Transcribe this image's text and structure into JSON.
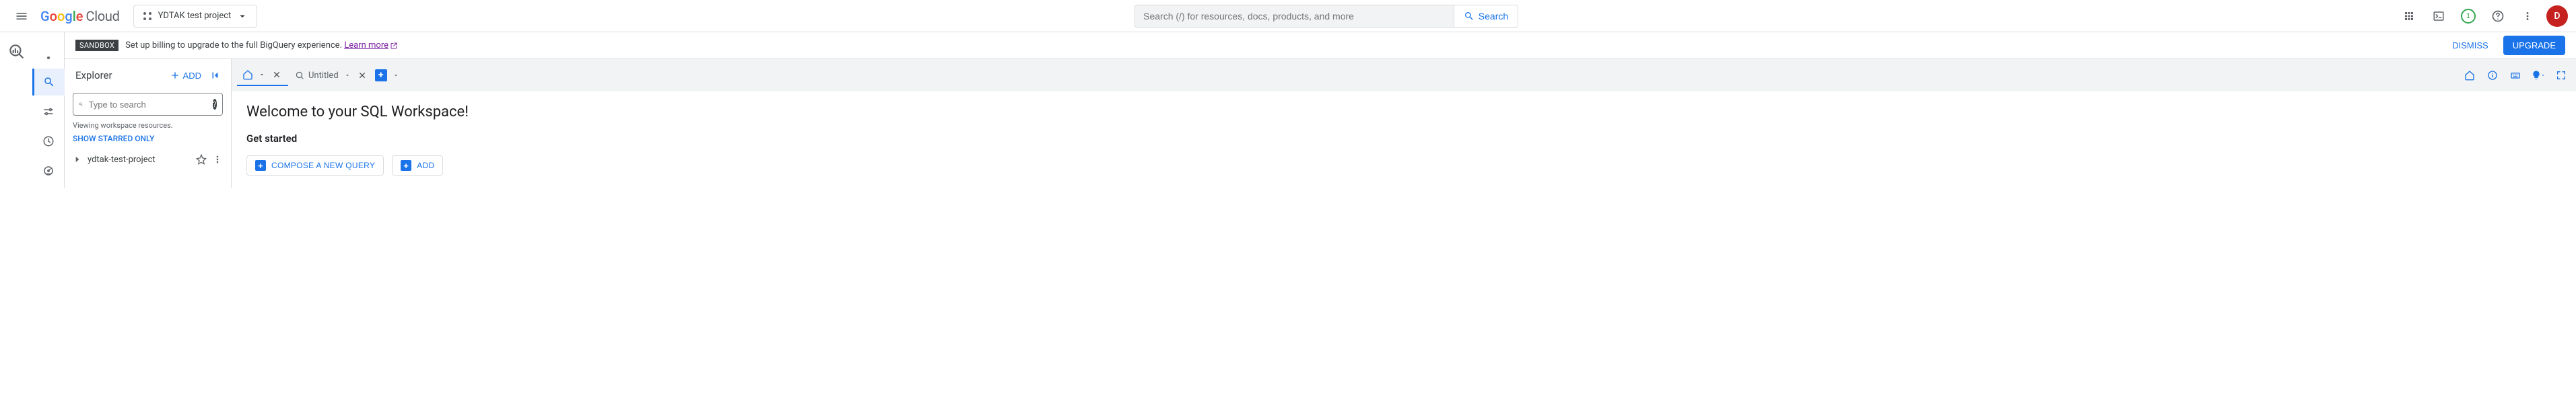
{
  "header": {
    "logo_cloud": "Cloud",
    "project_name": "YDTAK test project",
    "search_placeholder": "Search (/) for resources, docs, products, and more",
    "search_button": "Search",
    "notif_count": "1",
    "avatar_letter": "D"
  },
  "sandbox": {
    "badge": "SANDBOX",
    "text": "Set up billing to upgrade to the full BigQuery experience.",
    "link": "Learn more",
    "dismiss": "DISMISS",
    "upgrade": "UPGRADE"
  },
  "explorer": {
    "title": "Explorer",
    "add": "ADD",
    "search_placeholder": "Type to search",
    "viewing": "Viewing workspace resources.",
    "starred_link": "SHOW STARRED ONLY",
    "project": "ydtak-test-project"
  },
  "tabs": {
    "untitled": "Untitled"
  },
  "workspace": {
    "welcome": "Welcome to your SQL Workspace!",
    "get_started": "Get started",
    "compose": "COMPOSE A NEW QUERY",
    "add": "ADD"
  }
}
